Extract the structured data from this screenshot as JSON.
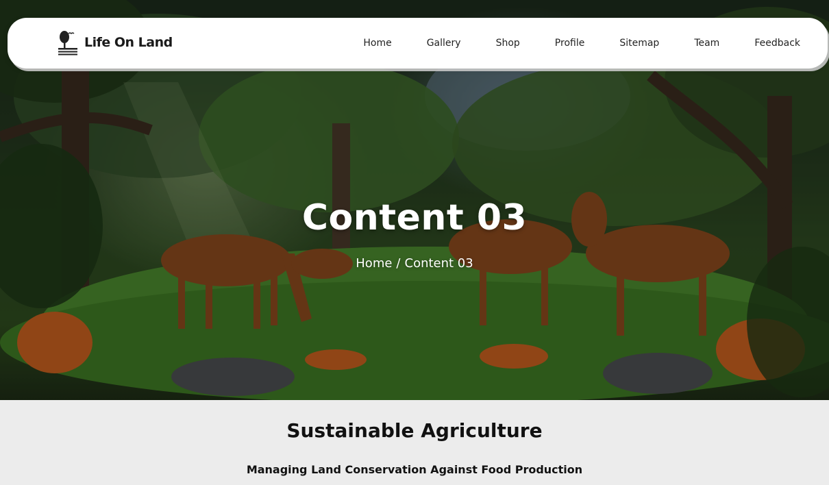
{
  "brand": {
    "name": "Life On Land",
    "logo_icon": "tree-logo-icon"
  },
  "nav": {
    "items": [
      {
        "label": "Home"
      },
      {
        "label": "Gallery"
      },
      {
        "label": "Shop"
      },
      {
        "label": "Profile"
      },
      {
        "label": "Sitemap"
      },
      {
        "label": "Team"
      },
      {
        "label": "Feedback"
      }
    ]
  },
  "hero": {
    "title": "Content 03",
    "breadcrumb": {
      "home": "Home",
      "separator": "/",
      "current": "Content 03"
    },
    "image_description_icon": "forest-deer-fox-illustration"
  },
  "section": {
    "title": "Sustainable Agriculture",
    "subtitle": "Managing Land Conservation Against Food Production"
  },
  "colors": {
    "navbar_bg": "#ffffff",
    "content_bg": "#ececec",
    "text_dark": "#111111",
    "hero_text": "#ffffff"
  }
}
